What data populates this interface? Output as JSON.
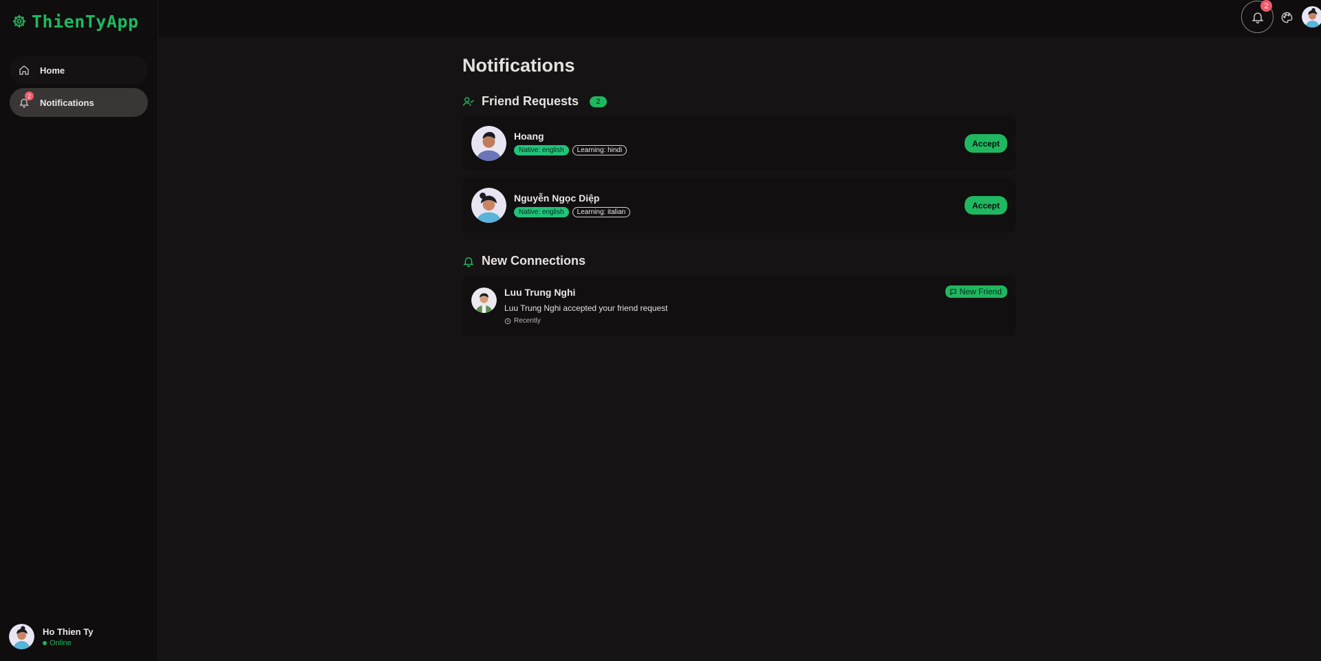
{
  "app": {
    "name": "ThienTyApp",
    "accent": "#1fb760"
  },
  "sidebar": {
    "items": [
      {
        "label": "Home",
        "icon": "home-icon"
      },
      {
        "label": "Notifications",
        "icon": "bell-icon",
        "badge": "2"
      }
    ],
    "user": {
      "name": "Ho Thien Ty",
      "status": "Online"
    }
  },
  "topbar": {
    "notification_count": "2"
  },
  "main": {
    "title": "Notifications",
    "friend_requests": {
      "title": "Friend Requests",
      "count": "2",
      "items": [
        {
          "name": "Hoang",
          "native": "Native: english",
          "learning": "Learning: hindi",
          "action": "Accept"
        },
        {
          "name": "Nguyễn Ngọc Diệp",
          "native": "Native: english",
          "learning": "Learning: italian",
          "action": "Accept"
        }
      ]
    },
    "new_connections": {
      "title": "New Connections",
      "items": [
        {
          "name": "Luu Trung Nghi",
          "message": "Luu Trung Nghi accepted your friend request",
          "time": "Recently",
          "badge": "New Friend"
        }
      ]
    }
  }
}
